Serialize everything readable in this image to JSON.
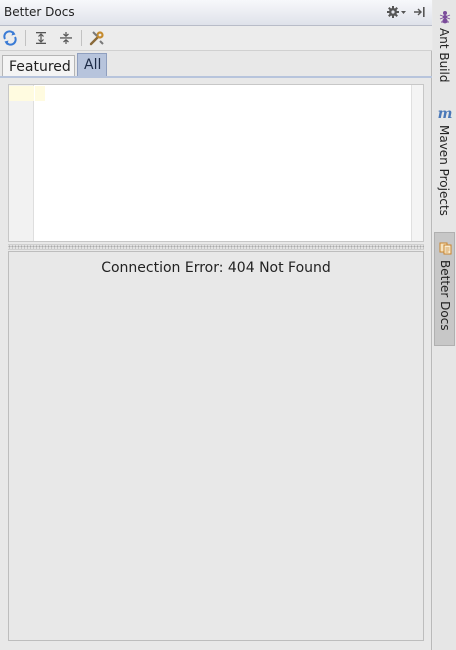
{
  "panel": {
    "title": "Better Docs",
    "title_icons": [
      "gear-dropdown-icon",
      "hide-panel-icon"
    ]
  },
  "toolbar": {
    "tools": [
      "refresh-icon",
      "expand-all-icon",
      "collapse-all-icon",
      "settings-tools-icon"
    ]
  },
  "tabs": [
    {
      "label": "Featured",
      "selected": false
    },
    {
      "label": "All",
      "selected": true
    }
  ],
  "editor": {
    "content": ""
  },
  "result": {
    "message": "Connection Error: 404  Not Found"
  },
  "side_tabs": [
    {
      "label": "Ant Build",
      "icon": "ant-icon",
      "active": false
    },
    {
      "label": "Maven Projects",
      "icon": "maven-m-icon",
      "icon_text": "m",
      "active": false
    },
    {
      "label": "Better Docs",
      "icon": "better-docs-icon",
      "active": true
    }
  ],
  "colors": {
    "tab_selected": "#b7c4dc",
    "refresh_icon": "#3a7bd5",
    "maven_icon": "#4a78b8"
  }
}
